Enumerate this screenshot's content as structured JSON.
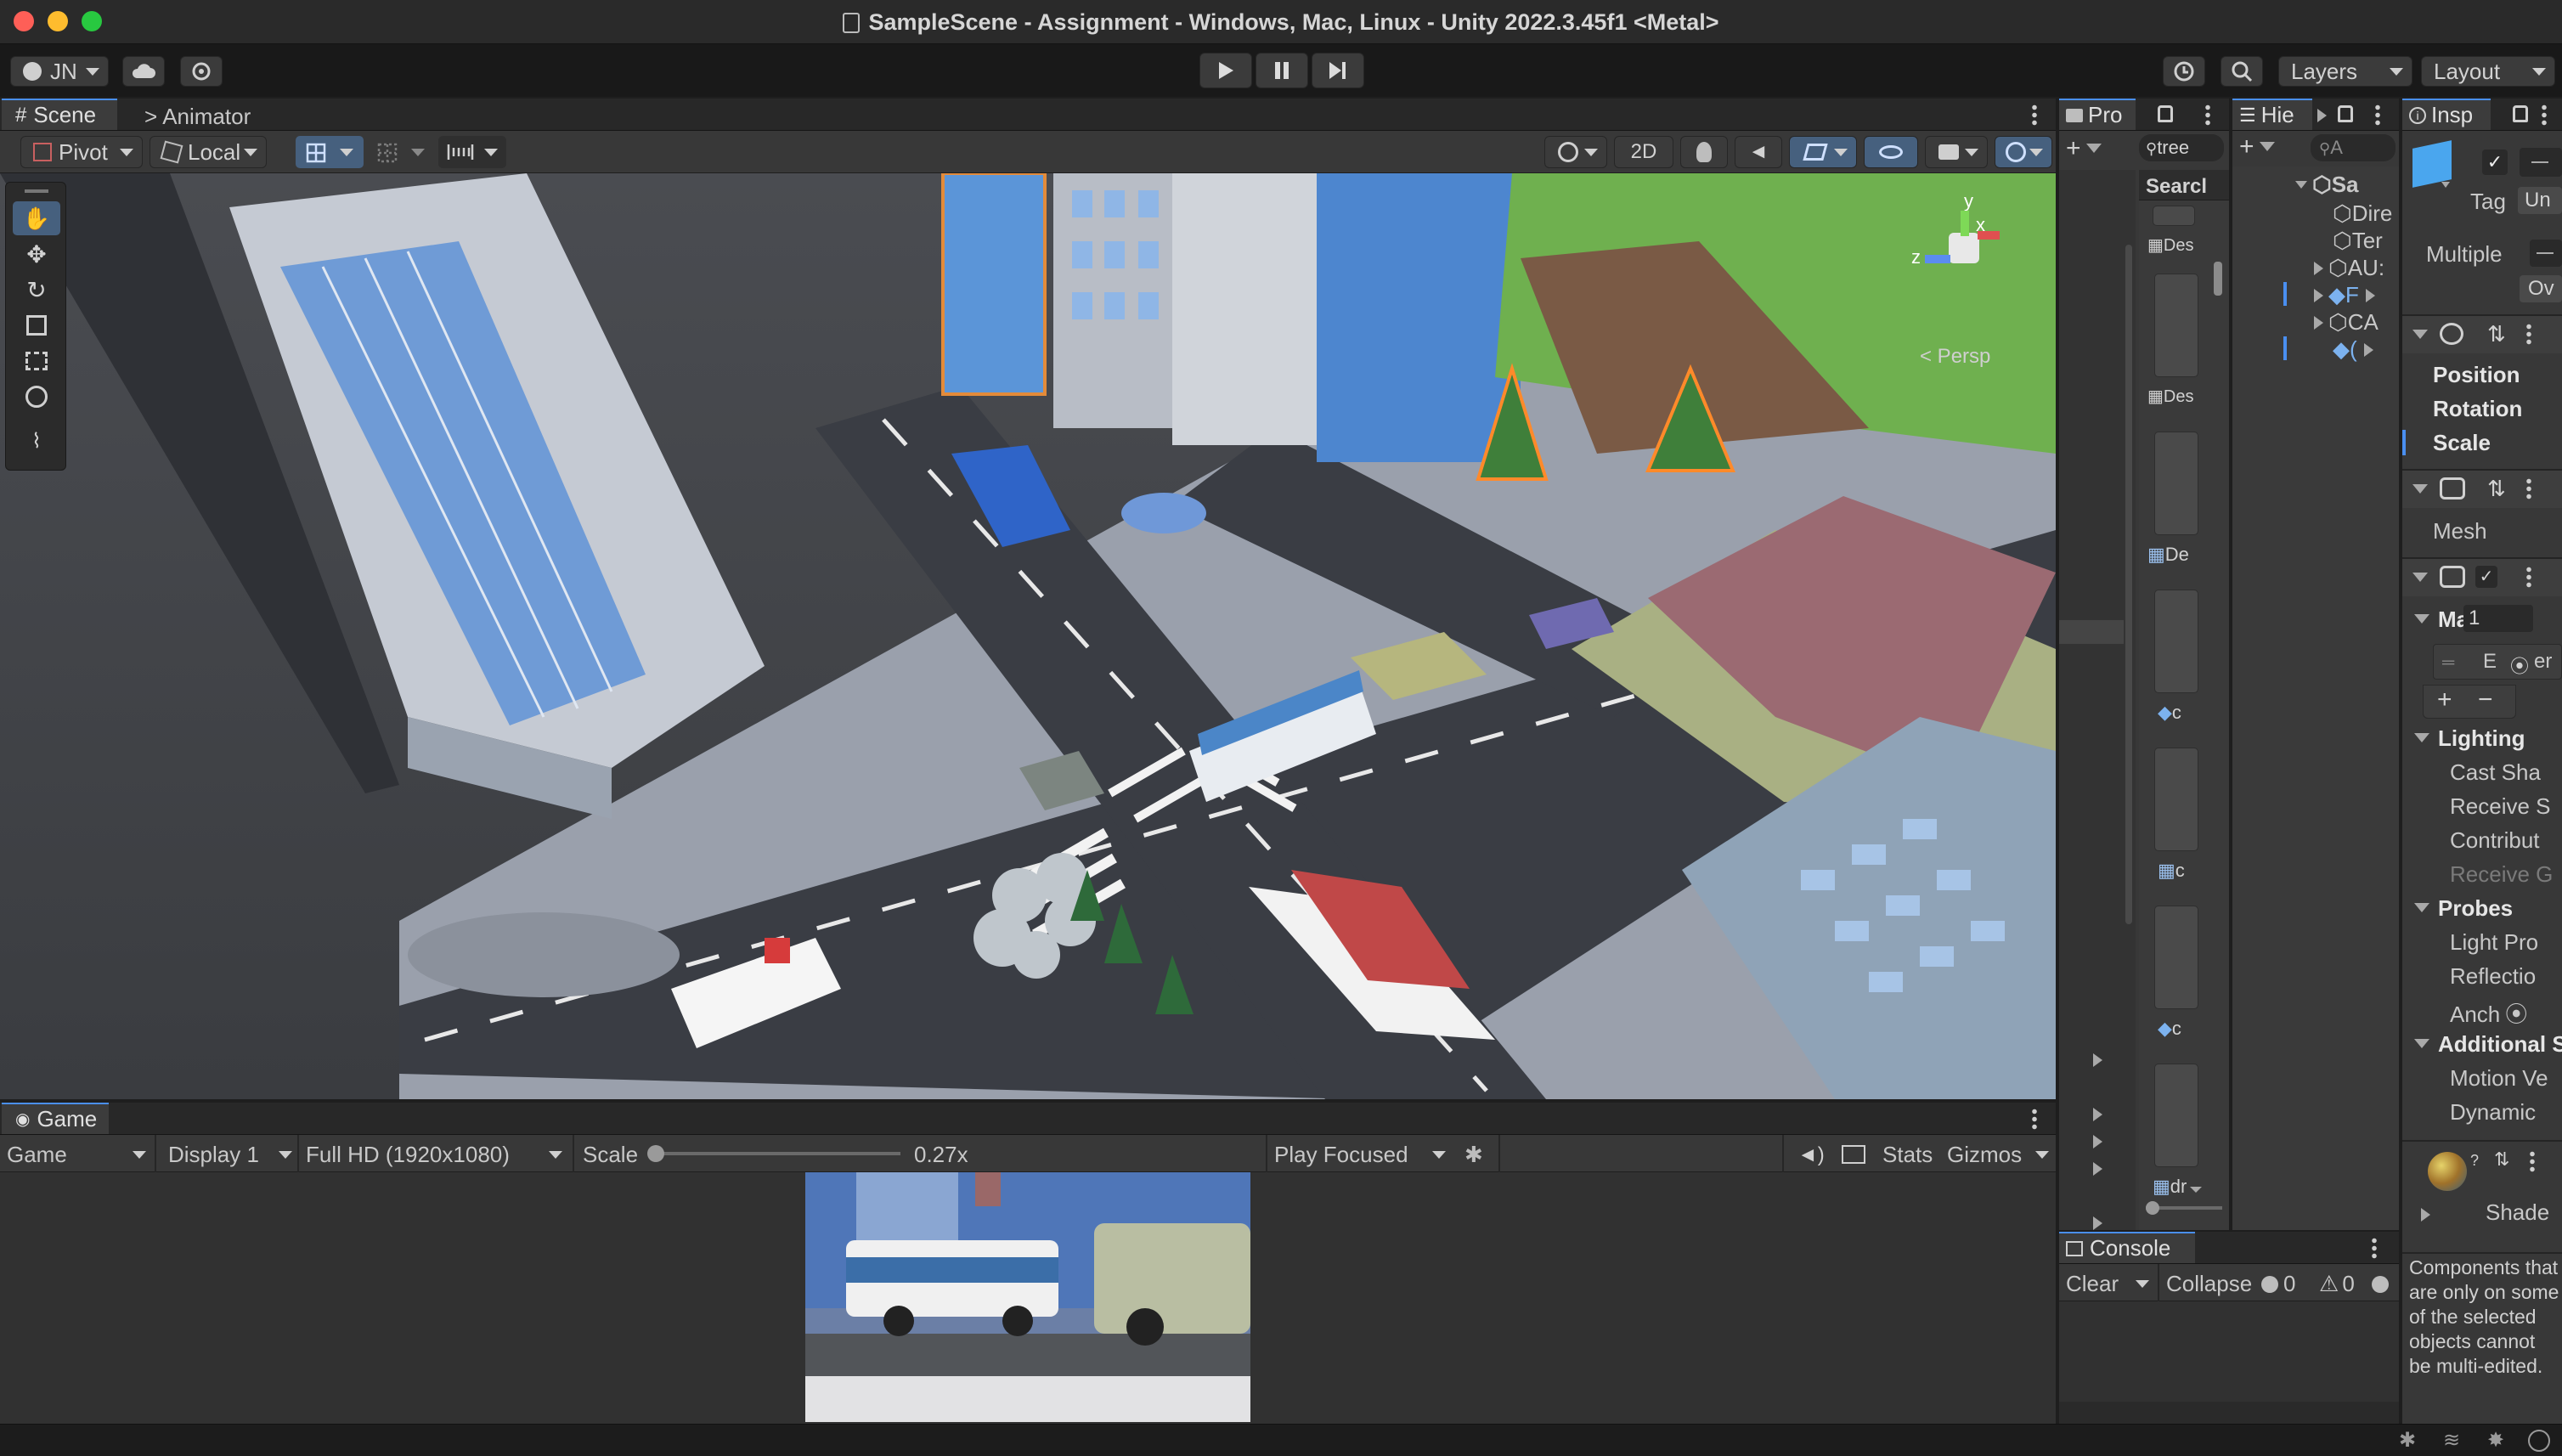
{
  "window": {
    "title": "SampleScene - Assignment - Windows, Mac, Linux - Unity 2022.3.45f1 <Metal>"
  },
  "toolbar": {
    "account": "JN",
    "layers_label": "Layers",
    "layout_label": "Layout"
  },
  "scene_panel": {
    "tabs": [
      "Scene",
      "Animator"
    ],
    "pivot_label": "Pivot",
    "local_label": "Local",
    "mode_2d": "2D",
    "persp_label": "< Persp",
    "gizmo_axes": {
      "y": "y",
      "x": "x",
      "z": "z"
    }
  },
  "game_panel": {
    "tab": "Game",
    "view_select": "Game",
    "display": "Display 1",
    "resolution": "Full HD (1920x1080)",
    "scale_label": "Scale",
    "scale_value": "0.27x",
    "scale_fraction": 0.0,
    "play_mode": "Play Focused",
    "stats": "Stats",
    "gizmos": "Gizmos"
  },
  "project_panel": {
    "tab": "Pro",
    "search_value": "tree",
    "search_header": "Searcl",
    "items": [
      "Des",
      "Des",
      "De",
      "c",
      "c",
      "c",
      "dr"
    ]
  },
  "hierarchy_panel": {
    "tab": "Hie",
    "search_placeholder": "A",
    "scene_name": "Sa",
    "items": [
      "Dire",
      "Ter",
      "AU:",
      "F",
      "CA",
      "("
    ]
  },
  "inspector_panel": {
    "tab": "Insp",
    "tag_label": "Tag",
    "tag_value": "Un",
    "multiple_label": "Multiple",
    "override_label": "Ov",
    "transform": {
      "position": "Position",
      "rotation": "Rotation",
      "scale": "Scale"
    },
    "mesh_label": "Mesh",
    "materials_label": "Ma",
    "materials_count": "1",
    "element_label": "E",
    "element_suffix": "er",
    "lighting_header": "Lighting",
    "lighting_items": [
      "Cast Sha",
      "Receive S",
      "Contribut",
      "Receive G"
    ],
    "probes_header": "Probes",
    "probes_items": [
      "Light Pro",
      "Reflectio",
      "Anch"
    ],
    "additional_header": "Additional S",
    "additional_items": [
      "Motion Ve",
      "Dynamic"
    ],
    "shader_label": "Shade",
    "multi_edit_note": "Components that are only on some of the selected objects cannot be multi-edited."
  },
  "console_panel": {
    "tab": "Console",
    "clear": "Clear",
    "collapse": "Collapse",
    "info_count": "0",
    "warn_count": "0"
  },
  "colors": {
    "accent": "#4a8ff0",
    "play_accent": "#3b7bd8"
  }
}
